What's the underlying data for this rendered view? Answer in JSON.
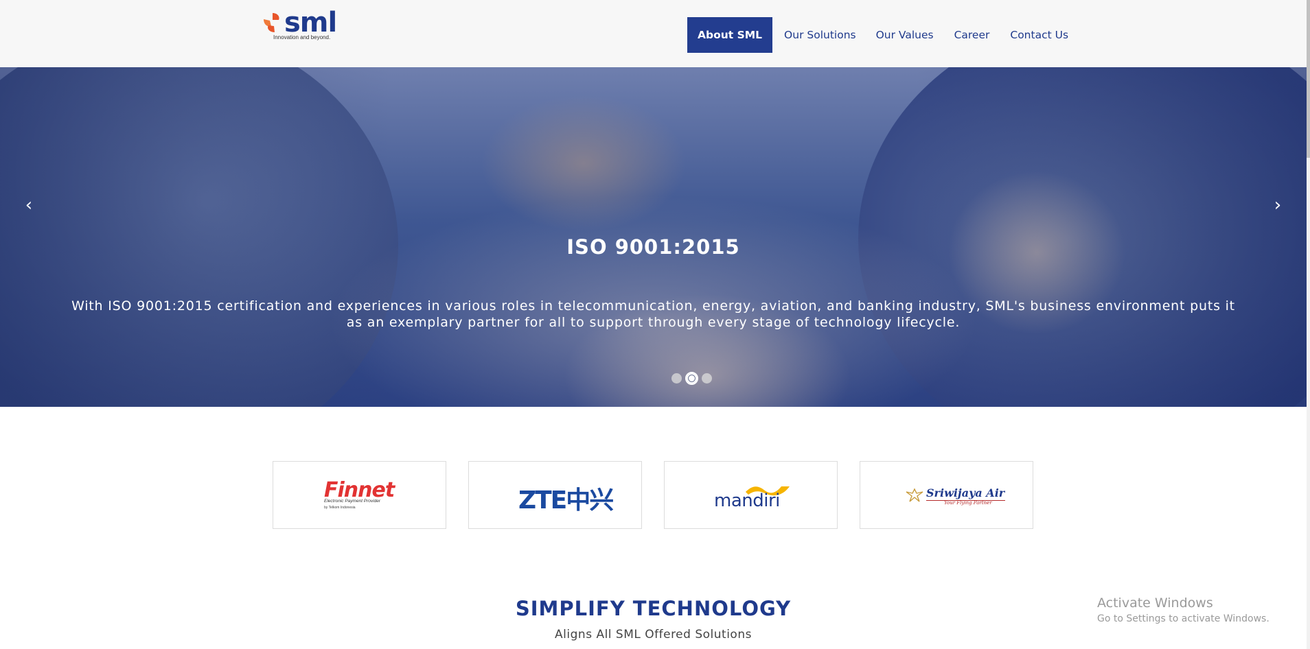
{
  "header": {
    "logo_text": "sml",
    "logo_tagline": "Innovation and beyond.",
    "nav": [
      {
        "label": "About SML"
      },
      {
        "label": "Our Solutions"
      },
      {
        "label": "Our Values"
      },
      {
        "label": "Career"
      },
      {
        "label": "Contact Us"
      }
    ]
  },
  "hero": {
    "title": "ISO 9001:2015",
    "text": "With ISO 9001:2015 certification and experiences in various roles in telecommunication, energy, aviation, and banking industry, SML's business environment puts it as an exemplary partner for all to support through every stage of technology lifecycle.",
    "prev_icon": "chevron-left-icon",
    "next_icon": "chevron-right-icon",
    "slides_total": 3,
    "active_slide": 2
  },
  "partners": [
    {
      "name": "Finnet",
      "tagline": "Electronic Payment Provider",
      "sub": "by Telkom Indonesia"
    },
    {
      "name": "ZTE中兴"
    },
    {
      "name": "mandiri"
    },
    {
      "name": "Sriwijaya Air",
      "tagline": "Your Flying Partner"
    }
  ],
  "section": {
    "title": "SIMPLIFY TECHNOLOGY",
    "subtitle": "Aligns All SML Offered Solutions"
  },
  "watermark": {
    "line1": "Activate Windows",
    "line2": "Go to Settings to activate Windows."
  },
  "colors": {
    "brand_blue": "#1f3a8c",
    "nav_active_bg": "#233d8f",
    "logo_orange": "#e8552a"
  }
}
